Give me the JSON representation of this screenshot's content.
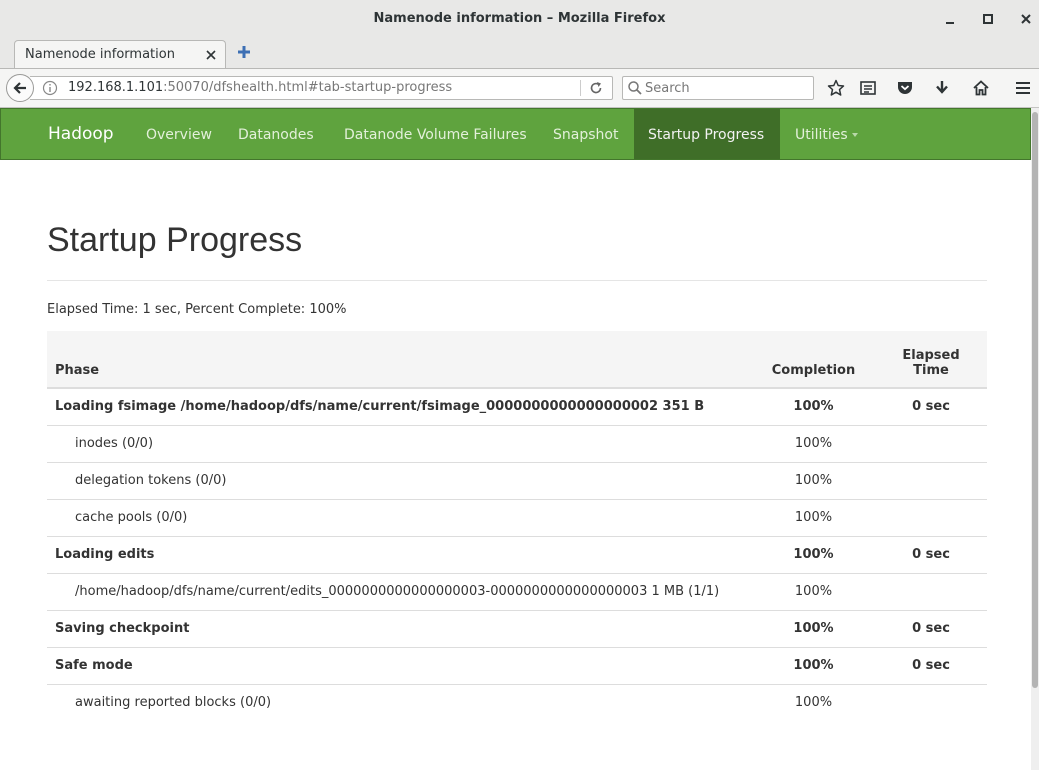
{
  "window": {
    "title": "Namenode information – Mozilla Firefox"
  },
  "tab": {
    "label": "Namenode information"
  },
  "urlbar": {
    "host": "192.168.1.101",
    "rest": ":50070/dfshealth.html#tab-startup-progress"
  },
  "search": {
    "placeholder": "Search"
  },
  "navbar": {
    "brand": "Hadoop",
    "items": [
      "Overview",
      "Datanodes",
      "Datanode Volume Failures",
      "Snapshot",
      "Startup Progress",
      "Utilities"
    ],
    "active": "Startup Progress"
  },
  "main": {
    "title": "Startup Progress",
    "summary": "Elapsed Time: 1 sec, Percent Complete: 100%",
    "table": {
      "headers": {
        "phase": "Phase",
        "completion": "Completion",
        "elapsed": "Elapsed Time"
      },
      "rows": [
        {
          "kind": "phase",
          "phase": "Loading fsimage /home/hadoop/dfs/name/current/fsimage_0000000000000000002 351 B",
          "completion": "100%",
          "elapsed": "0 sec"
        },
        {
          "kind": "step",
          "phase": "inodes (0/0)",
          "completion": "100%",
          "elapsed": ""
        },
        {
          "kind": "step",
          "phase": "delegation tokens (0/0)",
          "completion": "100%",
          "elapsed": ""
        },
        {
          "kind": "step",
          "phase": "cache pools (0/0)",
          "completion": "100%",
          "elapsed": ""
        },
        {
          "kind": "phase",
          "phase": "Loading edits",
          "completion": "100%",
          "elapsed": "0 sec"
        },
        {
          "kind": "step",
          "phase": "/home/hadoop/dfs/name/current/edits_0000000000000000003-0000000000000000003 1 MB (1/1)",
          "completion": "100%",
          "elapsed": ""
        },
        {
          "kind": "phase",
          "phase": "Saving checkpoint",
          "completion": "100%",
          "elapsed": "0 sec"
        },
        {
          "kind": "phase",
          "phase": "Safe mode",
          "completion": "100%",
          "elapsed": "0 sec"
        },
        {
          "kind": "step",
          "phase": "awaiting reported blocks (0/0)",
          "completion": "100%",
          "elapsed": ""
        }
      ]
    }
  },
  "colors": {
    "navbar_bg": "#5fa33e",
    "navbar_active_bg": "#3f6e28"
  },
  "icons": [
    "minimize-icon",
    "maximize-icon",
    "close-icon",
    "new-tab-icon",
    "back-arrow-icon",
    "info-icon",
    "reload-icon",
    "search-icon",
    "bookmark-star-icon",
    "reading-list-icon",
    "pocket-icon",
    "download-icon",
    "home-icon",
    "hamburger-menu-icon"
  ]
}
